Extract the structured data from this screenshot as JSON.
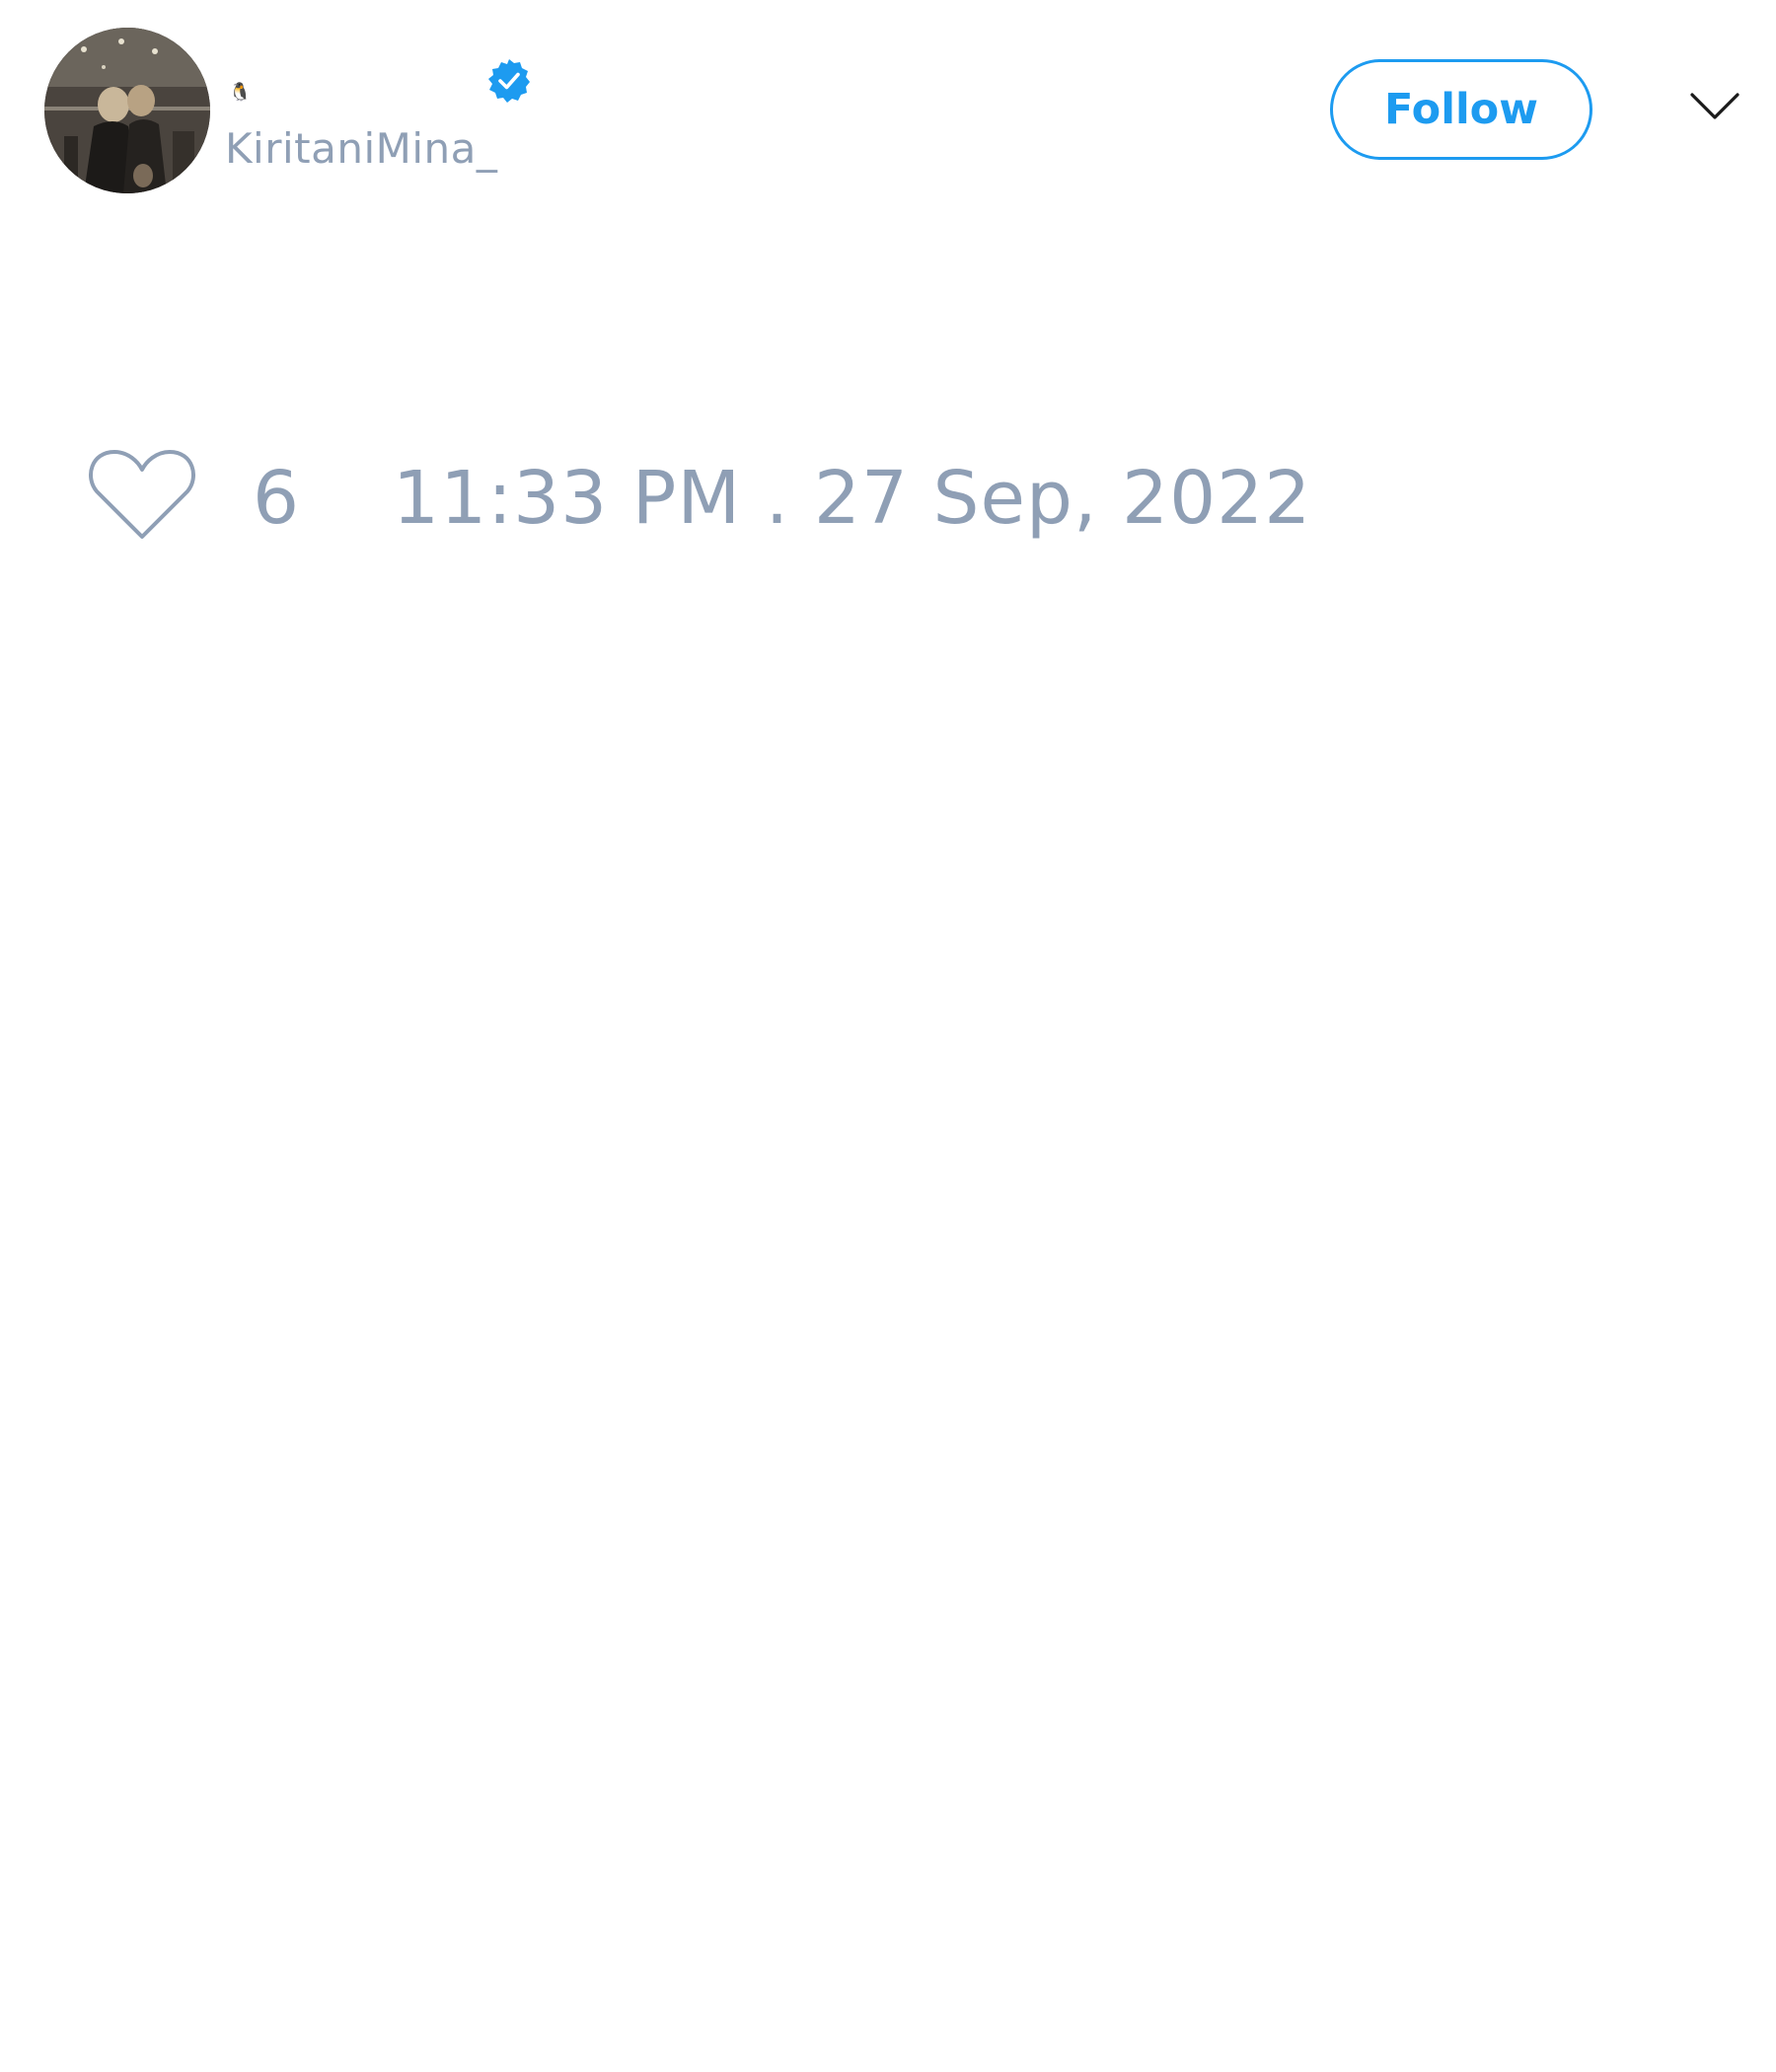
{
  "author": {
    "display_name": "🐧",
    "handle": "KiritaniMina_",
    "verified": true,
    "avatar_icon": "profile-photo",
    "verified_color": "#1d9bf0"
  },
  "header": {
    "follow_label": "Follow",
    "menu_icon": "chevron-down-icon"
  },
  "actions": {
    "like_icon": "heart-outline-icon",
    "like_count": "6",
    "timestamp": "11:33 PM . 27 Sep, 2022"
  },
  "colors": {
    "accent": "#1d9bf0",
    "muted_text": "#8f9fb5",
    "background": "#ffffff"
  }
}
